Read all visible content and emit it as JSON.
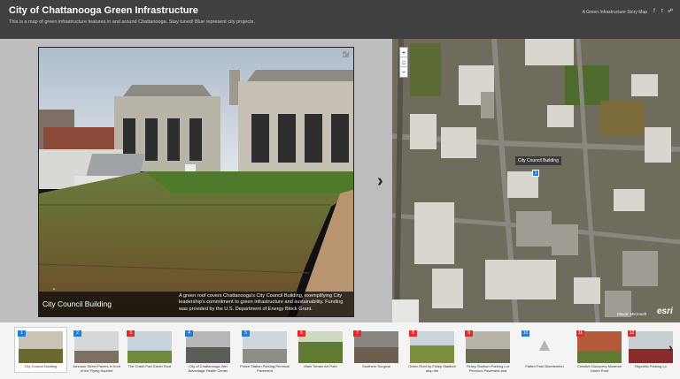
{
  "header": {
    "title": "City of Chattanooga Green Infrastructure",
    "subtitle": "This is a map of green infrastructure features in and around Chattanooga. Stay tuned! Blue represent city projects.",
    "link": "A Green Infrastructure Story Map",
    "share_icons": [
      "facebook-icon",
      "twitter-icon",
      "link-icon"
    ]
  },
  "photo": {
    "expand_icon": "expand-icon",
    "title": "City Council Building",
    "description": "A green roof covers Chattanooga's City Council Building, exemplifying City leadership's commitment to green infrastructure and sustainability. Funding was provided by the U.S. Department of Energy Block Grant."
  },
  "map": {
    "zoom_in": "+",
    "home_icon": "home-icon",
    "zoom_out": "−",
    "tooltip": "City Council Building",
    "marker_number": "1",
    "attribution": "Maxar, Microsoft",
    "logo": "esri"
  },
  "colors": {
    "city_project": "#1f7fd6",
    "other_project": "#d9302c",
    "header_bg": "#404040"
  },
  "thumbnails": [
    {
      "number": "1",
      "label": "City Council Building",
      "color": "blue"
    },
    {
      "number": "2",
      "label": "Johnson Street Pavers in front of the Flying Squirrel",
      "color": "blue"
    },
    {
      "number": "3",
      "label": "The Crash Pad Green Roof",
      "color": "red"
    },
    {
      "number": "4",
      "label": "City of Chattanooga Wet Advantage Health Center",
      "color": "blue"
    },
    {
      "number": "5",
      "label": "Police Station Parking Pervious Pavement",
      "color": "blue"
    },
    {
      "number": "6",
      "label": "Main Terrain Art Park",
      "color": "red"
    },
    {
      "number": "7",
      "label": "Southern Surgical",
      "color": "red"
    },
    {
      "number": "8",
      "label": "Green Roof by Finley Stadium atop the",
      "color": "red"
    },
    {
      "number": "9",
      "label": "Finley Stadium Parking Lot Pervious Pavement and",
      "color": "red"
    },
    {
      "number": "10",
      "label": "Patten Park Bioretention",
      "color": "blue"
    },
    {
      "number": "11",
      "label": "Creative Discovery Museum Green Roof",
      "color": "red"
    },
    {
      "number": "12",
      "label": "Republic Parking Lo",
      "color": "red"
    }
  ]
}
